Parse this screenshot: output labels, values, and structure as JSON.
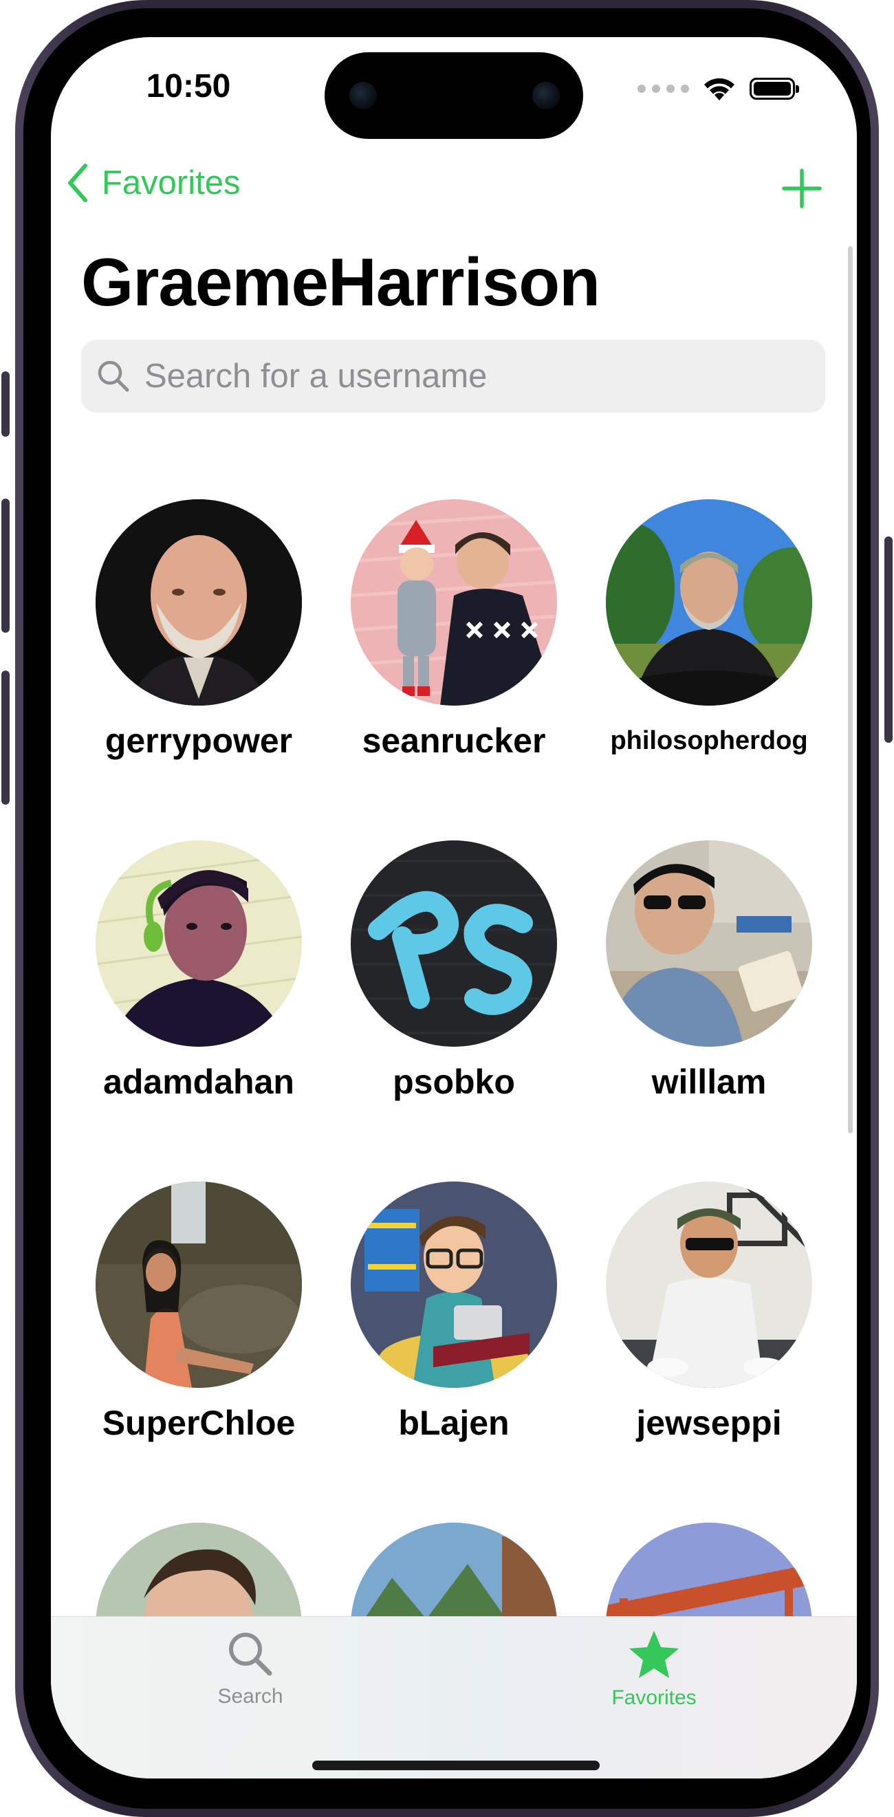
{
  "status_bar": {
    "time": "10:50"
  },
  "nav": {
    "back_label": "Favorites",
    "back_icon": "chevron-left-icon",
    "add_icon": "plus-icon",
    "title": "GraemeHarrison"
  },
  "search": {
    "placeholder": "Search for a username",
    "value": "",
    "icon": "magnifying-glass-icon"
  },
  "favorites": [
    {
      "username": "gerrypower"
    },
    {
      "username": "seanrucker"
    },
    {
      "username": "philosopherdog"
    },
    {
      "username": "adamdahan"
    },
    {
      "username": "psobko"
    },
    {
      "username": "willlam"
    },
    {
      "username": "SuperChloe"
    },
    {
      "username": "bLajen"
    },
    {
      "username": "jewseppi"
    }
  ],
  "tab_bar": {
    "tabs": [
      {
        "label": "Search",
        "icon": "magnifying-glass-icon",
        "selected": false
      },
      {
        "label": "Favorites",
        "icon": "star-icon",
        "selected": true
      }
    ]
  },
  "colors": {
    "accent": "#34c759",
    "inactive_tab": "#8e8e93",
    "search_bg": "#efeff0"
  }
}
